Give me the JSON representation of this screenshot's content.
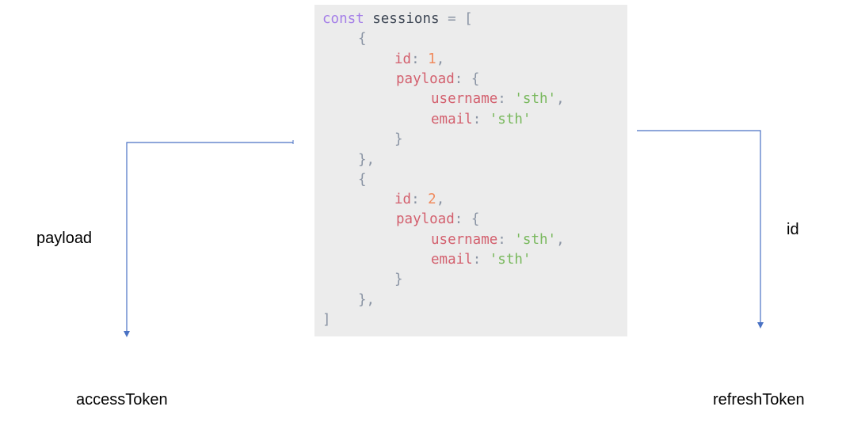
{
  "code": {
    "keyword": "const",
    "variable": "sessions",
    "assign": " = ",
    "open_bracket": "[",
    "close_bracket": "]",
    "open_brace": "{",
    "close_brace": "}",
    "close_brace_comma": "},",
    "items": [
      {
        "id_key": "id",
        "id_value": "1",
        "payload_key": "payload",
        "username_key": "username",
        "username_value": "'sth'",
        "email_key": "email",
        "email_value": "'sth'"
      },
      {
        "id_key": "id",
        "id_value": "2",
        "payload_key": "payload",
        "username_key": "username",
        "username_value": "'sth'",
        "email_key": "email",
        "email_value": "'sth'"
      }
    ]
  },
  "labels": {
    "left_edge": "payload",
    "right_edge": "id",
    "left_target": "accessToken",
    "right_target": "refreshToken"
  },
  "colors": {
    "code_background": "#ececec",
    "keyword": "#a47ee8",
    "identifier": "#3d4654",
    "property": "#d3606e",
    "number": "#f08a5d",
    "string": "#78b85c",
    "punctuation": "#8a94a4",
    "connector": "#4a72c4"
  }
}
